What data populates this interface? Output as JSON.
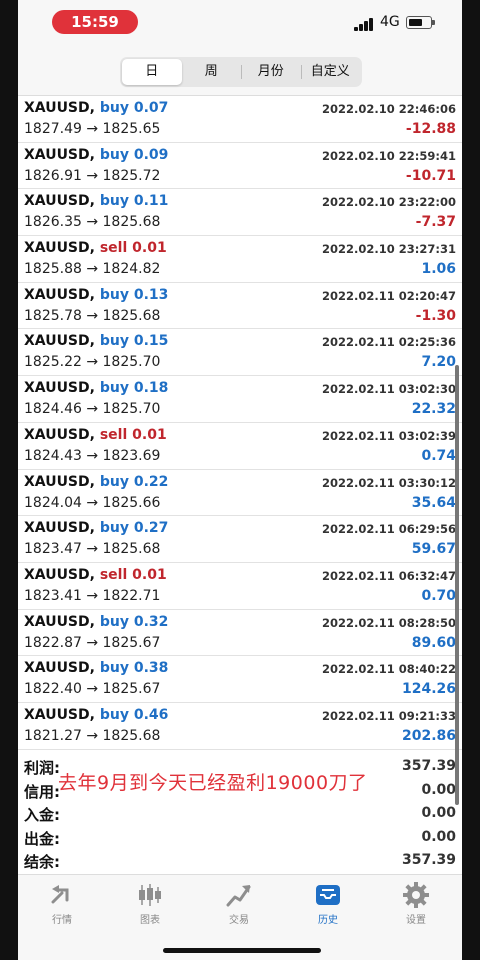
{
  "status": {
    "time": "15:59",
    "network": "4G"
  },
  "tabs_top": [
    {
      "label": "日",
      "active": true
    },
    {
      "label": "周",
      "active": false
    },
    {
      "label": "月份",
      "active": false
    },
    {
      "label": "自定义",
      "active": false
    }
  ],
  "trades": [
    {
      "symbol": "XAUUSD,",
      "side": "buy",
      "side_label": "buy 0.07",
      "date": "2022.02.10 22:46:06",
      "prices": "1827.49 → 1825.65",
      "profit": "-12.88"
    },
    {
      "symbol": "XAUUSD,",
      "side": "buy",
      "side_label": "buy 0.09",
      "date": "2022.02.10 22:59:41",
      "prices": "1826.91 → 1825.72",
      "profit": "-10.71"
    },
    {
      "symbol": "XAUUSD,",
      "side": "buy",
      "side_label": "buy 0.11",
      "date": "2022.02.10 23:22:00",
      "prices": "1826.35 → 1825.68",
      "profit": "-7.37"
    },
    {
      "symbol": "XAUUSD,",
      "side": "sell",
      "side_label": "sell 0.01",
      "date": "2022.02.10 23:27:31",
      "prices": "1825.88 → 1824.82",
      "profit": "1.06"
    },
    {
      "symbol": "XAUUSD,",
      "side": "buy",
      "side_label": "buy 0.13",
      "date": "2022.02.11 02:20:47",
      "prices": "1825.78 → 1825.68",
      "profit": "-1.30"
    },
    {
      "symbol": "XAUUSD,",
      "side": "buy",
      "side_label": "buy 0.15",
      "date": "2022.02.11 02:25:36",
      "prices": "1825.22 → 1825.70",
      "profit": "7.20"
    },
    {
      "symbol": "XAUUSD,",
      "side": "buy",
      "side_label": "buy 0.18",
      "date": "2022.02.11 03:02:30",
      "prices": "1824.46 → 1825.70",
      "profit": "22.32"
    },
    {
      "symbol": "XAUUSD,",
      "side": "sell",
      "side_label": "sell 0.01",
      "date": "2022.02.11 03:02:39",
      "prices": "1824.43 → 1823.69",
      "profit": "0.74"
    },
    {
      "symbol": "XAUUSD,",
      "side": "buy",
      "side_label": "buy 0.22",
      "date": "2022.02.11 03:30:12",
      "prices": "1824.04 → 1825.66",
      "profit": "35.64"
    },
    {
      "symbol": "XAUUSD,",
      "side": "buy",
      "side_label": "buy 0.27",
      "date": "2022.02.11 06:29:56",
      "prices": "1823.47 → 1825.68",
      "profit": "59.67"
    },
    {
      "symbol": "XAUUSD,",
      "side": "sell",
      "side_label": "sell 0.01",
      "date": "2022.02.11 06:32:47",
      "prices": "1823.41 → 1822.71",
      "profit": "0.70"
    },
    {
      "symbol": "XAUUSD,",
      "side": "buy",
      "side_label": "buy 0.32",
      "date": "2022.02.11 08:28:50",
      "prices": "1822.87 → 1825.67",
      "profit": "89.60"
    },
    {
      "symbol": "XAUUSD,",
      "side": "buy",
      "side_label": "buy 0.38",
      "date": "2022.02.11 08:40:22",
      "prices": "1822.40 → 1825.67",
      "profit": "124.26"
    },
    {
      "symbol": "XAUUSD,",
      "side": "buy",
      "side_label": "buy 0.46",
      "date": "2022.02.11 09:21:33",
      "prices": "1821.27 → 1825.68",
      "profit": "202.86"
    }
  ],
  "summary": [
    {
      "label": "利润:",
      "value": "357.39"
    },
    {
      "label": "信用:",
      "value": "0.00"
    },
    {
      "label": "入金:",
      "value": "0.00"
    },
    {
      "label": "出金:",
      "value": "0.00"
    },
    {
      "label": "结余:",
      "value": "357.39"
    }
  ],
  "overlay_caption": "去年9月到今天已经盈利19000刀了",
  "bottom_tabs": [
    {
      "label": "行情",
      "icon": "quotes-icon",
      "active": false
    },
    {
      "label": "图表",
      "icon": "chart-candles-icon",
      "active": false
    },
    {
      "label": "交易",
      "icon": "trade-icon",
      "active": false
    },
    {
      "label": "历史",
      "icon": "history-inbox-icon",
      "active": true
    },
    {
      "label": "设置",
      "icon": "gear-icon",
      "active": false
    }
  ],
  "colors": {
    "buy": "#1f6fc5",
    "sell": "#c0262d",
    "accent": "#1f6fc5",
    "time_pill": "#e0323a"
  }
}
